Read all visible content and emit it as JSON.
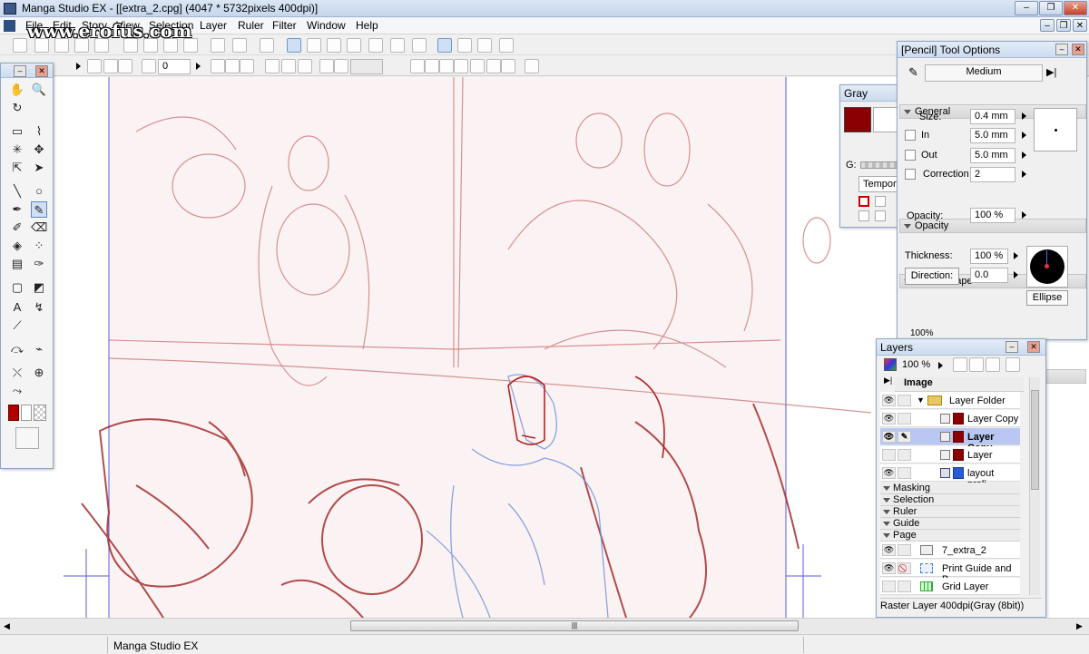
{
  "window": {
    "title": "Manga Studio EX - [[extra_2.cpg] (4047 * 5732pixels 400dpi)]",
    "min": "–",
    "max": "❐",
    "close": "✕"
  },
  "watermark": "www.erofus.com",
  "menu": [
    "File",
    "Edit",
    "Story",
    "View",
    "Selection",
    "Layer",
    "Ruler",
    "Filter",
    "Window",
    "Help"
  ],
  "toolbar2": {
    "field_value": "0"
  },
  "gray_panel": {
    "title": "Gray",
    "g_label": "G:",
    "temp_label": "Tempora"
  },
  "tool_options": {
    "title": "[Pencil] Tool Options",
    "preset": "Medium",
    "sections": {
      "general": "General",
      "opacity": "Opacity",
      "brush_shape": "Brush Shape",
      "pressure": "Pressure Settings"
    },
    "size_label": "Size:",
    "size_value": "0.4 mm",
    "in_label": "In",
    "in_value": "5.0 mm",
    "out_label": "Out",
    "out_value": "5.0 mm",
    "correction_label": "Correction",
    "correction_value": "2",
    "opacity_label": "Opacity:",
    "opacity_value": "100 %",
    "thickness_label": "Thickness:",
    "thickness_value": "100 %",
    "direction_label": "Direction:",
    "direction_value": "0.0",
    "shape_button": "Ellipse",
    "pressure_partial": "100%"
  },
  "layers": {
    "title": "Layers",
    "opacity": "100 %",
    "root": "Image",
    "items": [
      {
        "name": "Layer Folder",
        "eye": true,
        "selected": false
      },
      {
        "name": "Layer Copy",
        "eye": true,
        "selected": false
      },
      {
        "name": "Layer Copy",
        "eye": true,
        "selected": true
      },
      {
        "name": "Layer",
        "eye": false,
        "selected": false
      },
      {
        "name": "layout preli...",
        "eye": true,
        "selected": false
      }
    ],
    "sections": [
      "Masking",
      "Selection",
      "Ruler",
      "Guide",
      "Page"
    ],
    "page_items": [
      {
        "name": "7_extra_2"
      },
      {
        "name": "Print Guide and B..."
      },
      {
        "name": "Grid Layer"
      }
    ],
    "status": "Raster Layer 400dpi(Gray (8bit))"
  },
  "statusbar": {
    "app": "Manga Studio EX",
    "scroll_grip": "|||"
  },
  "colors": {
    "accent_red": "#8b0000",
    "sketch": "#b22222",
    "selection": "#b9c8f2",
    "blue_sketch": "#6f8fd8"
  }
}
